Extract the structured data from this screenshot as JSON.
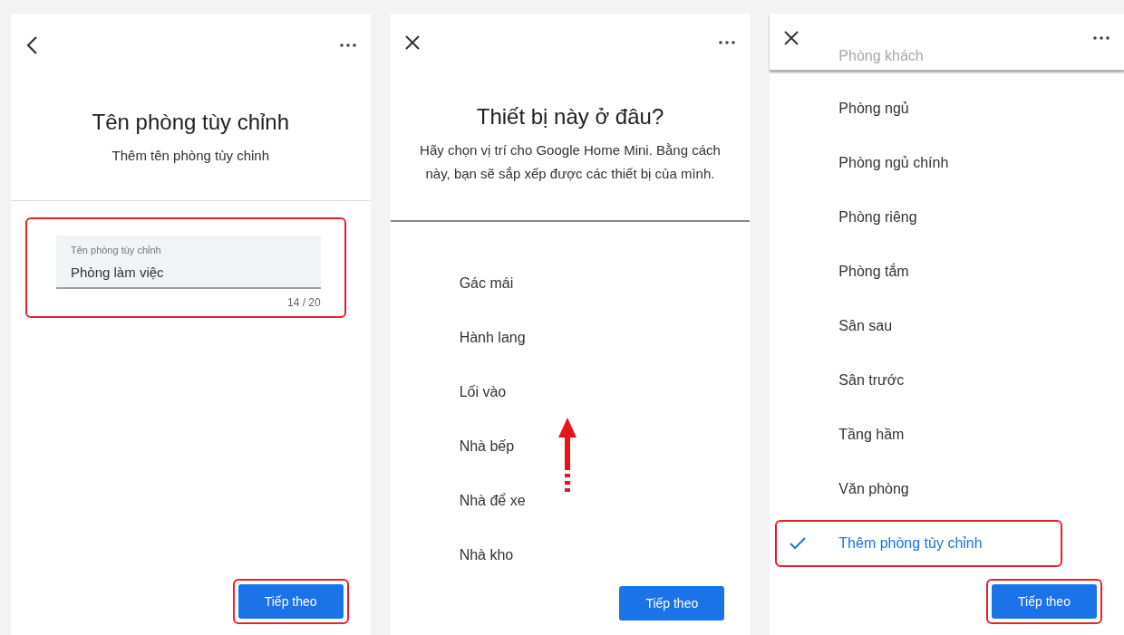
{
  "screens": [
    {
      "kind": "form",
      "nav": {
        "kind": "back"
      },
      "title": "Tên phòng tùy chỉnh",
      "subtitle": "Thêm tên phòng tùy chỉnh",
      "field": {
        "label": "Tên phòng tùy chỉnh",
        "value": "Phòng làm việc",
        "counter": "14 / 20",
        "highlighted": true
      },
      "button": {
        "label": "Tiếp theo",
        "highlighted": true
      }
    },
    {
      "kind": "list",
      "nav": {
        "kind": "close"
      },
      "title": "Thiết bị này ở đâu?",
      "subtitle": "Hãy chọn vị trí cho Google Home Mini. Bằng cách này, bạn sẽ sắp xếp được các thiết bị của mình.",
      "scroll_arrow": true,
      "items": [
        {
          "label": "Gác mái",
          "selected": false,
          "highlighted": false
        },
        {
          "label": "Hành lang",
          "selected": false,
          "highlighted": false
        },
        {
          "label": "Lối vào",
          "selected": false,
          "highlighted": false
        },
        {
          "label": "Nhà bếp",
          "selected": false,
          "highlighted": false
        },
        {
          "label": "Nhà để xe",
          "selected": false,
          "highlighted": false
        },
        {
          "label": "Nhà kho",
          "selected": false,
          "highlighted": false
        }
      ],
      "button": {
        "label": "Tiếp theo",
        "highlighted": false
      }
    },
    {
      "kind": "scrolled_list",
      "nav": {
        "kind": "close"
      },
      "faded_item": "Phòng khách",
      "items": [
        {
          "label": "Phòng ngủ",
          "selected": false,
          "highlighted": false
        },
        {
          "label": "Phòng ngủ chính",
          "selected": false,
          "highlighted": false
        },
        {
          "label": "Phòng riêng",
          "selected": false,
          "highlighted": false
        },
        {
          "label": "Phòng tắm",
          "selected": false,
          "highlighted": false
        },
        {
          "label": "Sân sau",
          "selected": false,
          "highlighted": false
        },
        {
          "label": "Sân trước",
          "selected": false,
          "highlighted": false
        },
        {
          "label": "Tầng hầm",
          "selected": false,
          "highlighted": false
        },
        {
          "label": "Văn phòng",
          "selected": false,
          "highlighted": false
        },
        {
          "label": "Thêm phòng tùy chỉnh",
          "selected": true,
          "highlighted": true
        }
      ],
      "button": {
        "label": "Tiếp theo",
        "highlighted": true
      }
    }
  ]
}
